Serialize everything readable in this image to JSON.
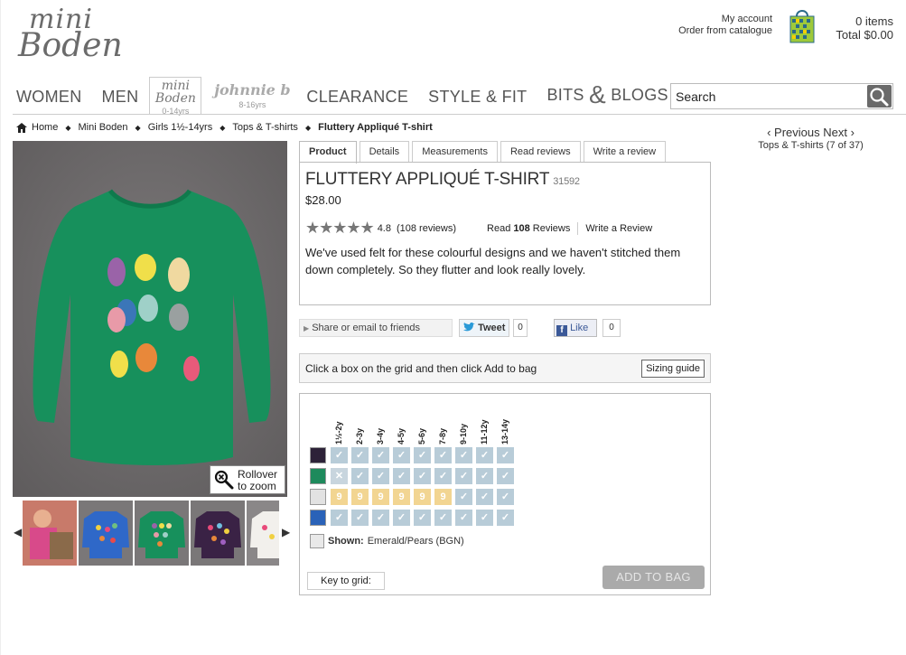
{
  "brand": {
    "line1": "mini",
    "line2": "Boden"
  },
  "account": {
    "my_account": "My account",
    "order_catalogue": "Order from catalogue"
  },
  "cart": {
    "items": "0 items",
    "total": "Total $0.00"
  },
  "nav": {
    "women": "WOMEN",
    "men": "MEN",
    "mini_boden": {
      "name": "mini Boden",
      "ages": "0-14yrs"
    },
    "johnnie_b": {
      "name": "johnnie b",
      "ages": "8-16yrs"
    },
    "clearance": "CLEARANCE",
    "style_fit": "STYLE & FIT",
    "bits": "BITS",
    "amp": "&",
    "blogs": "BLOGS"
  },
  "search": {
    "placeholder": "Search"
  },
  "breadcrumb": [
    "Home",
    "Mini Boden",
    "Girls 1½-14yrs",
    "Tops & T-shirts",
    "Fluttery Appliqué T-shirt"
  ],
  "prevnext": {
    "prev": "‹ Previous",
    "next": "Next ›",
    "sub": "Tops & T-shirts (7 of 37)"
  },
  "zoom_hint": {
    "line1": "Rollover",
    "line2": "to zoom"
  },
  "tabs": [
    "Product",
    "Details",
    "Measurements",
    "Read reviews",
    "Write a review"
  ],
  "product": {
    "title": "FLUTTERY APPLIQUÉ T-SHIRT",
    "code": "31592",
    "price": "$28.00",
    "rating": "4.8",
    "stars_filled": 4.8,
    "reviews_count": "(108 reviews)",
    "read_prefix": "Read",
    "read_count": "108",
    "read_suffix": "Reviews",
    "write_review": "Write a Review",
    "description": "We've used felt for these colourful designs and we haven't stitched them down completely. So they flutter and look really lovely."
  },
  "social": {
    "share": "Share or email to friends",
    "tweet": "Tweet",
    "tweet_count": "0",
    "like": "Like",
    "like_count": "0"
  },
  "grid": {
    "instruction": "Click a box on the grid and then click Add to bag",
    "sizing_guide": "Sizing guide",
    "sizes": [
      "1½-2y",
      "2-3y",
      "3-4y",
      "4-5y",
      "5-6y",
      "7-8y",
      "9-10y",
      "11-12y",
      "13-14y"
    ],
    "rows": [
      {
        "color": "#2d2238",
        "cells": [
          "ok",
          "ok",
          "ok",
          "ok",
          "ok",
          "ok",
          "ok",
          "ok",
          "ok"
        ]
      },
      {
        "color": "#1e8a5c",
        "cells": [
          "x",
          "ok",
          "ok",
          "ok",
          "ok",
          "ok",
          "ok",
          "ok",
          "ok"
        ]
      },
      {
        "color": "#e2e2e2",
        "cells": [
          "lim",
          "lim",
          "lim",
          "lim",
          "lim",
          "lim",
          "ok",
          "ok",
          "ok"
        ]
      },
      {
        "color": "#2a62b8",
        "cells": [
          "ok",
          "ok",
          "ok",
          "ok",
          "ok",
          "ok",
          "ok",
          "ok",
          "ok"
        ]
      }
    ],
    "glyphs": {
      "ok": "✓",
      "x": "✕",
      "lim": "9"
    },
    "shown_label": "Shown:",
    "shown_value": "Emerald/Pears (BGN)",
    "key": "Key to grid:",
    "add_to_bag": "ADD TO BAG"
  },
  "colors": {
    "hero_bg": "#6f6c6d",
    "shirt": "#17905c",
    "grid_ok": "#b8ccd8",
    "grid_limited": "#f2d592"
  }
}
